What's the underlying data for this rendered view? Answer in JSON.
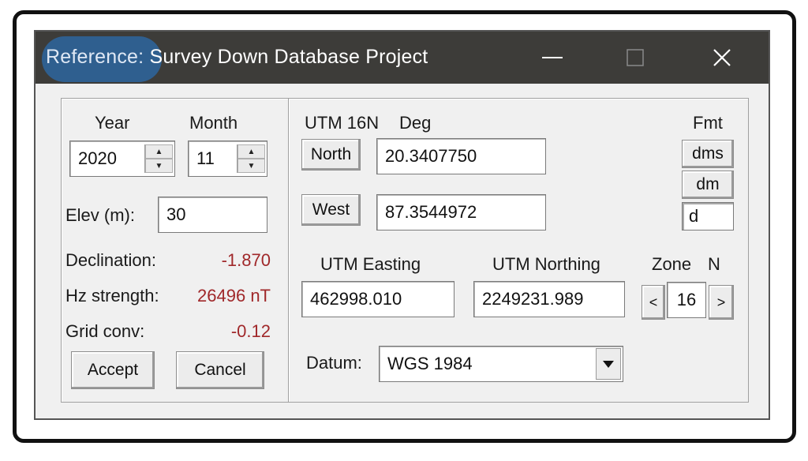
{
  "window": {
    "title_prefix": "Reference:",
    "title_rest": " Survey Down Database Project"
  },
  "left": {
    "year_label": "Year",
    "month_label": "Month",
    "year_value": "2020",
    "month_value": "11",
    "elev_label": "Elev (m):",
    "elev_value": "30",
    "declination_label": "Declination:",
    "declination_value": "-1.870",
    "hz_label": "Hz strength:",
    "hz_value": "26496 nT",
    "grid_label": "Grid conv:",
    "grid_value": "-0.12",
    "accept_label": "Accept",
    "cancel_label": "Cancel"
  },
  "right": {
    "utm_zone_label": "UTM 16N",
    "deg_label": "Deg",
    "fmt_label": "Fmt",
    "north_button": "North",
    "north_value": "20.3407750",
    "west_button": "West",
    "west_value": "87.3544972",
    "fmt_dms": "dms",
    "fmt_dm": "dm",
    "fmt_d": "d",
    "easting_label": "UTM Easting",
    "northing_label": "UTM Northing",
    "zone_label": "Zone",
    "hemisphere": "N",
    "easting_value": "462998.010",
    "northing_value": "2249231.989",
    "zone_value": "16",
    "zone_prev": "<",
    "zone_next": ">",
    "datum_label": "Datum:",
    "datum_value": "WGS 1984"
  }
}
